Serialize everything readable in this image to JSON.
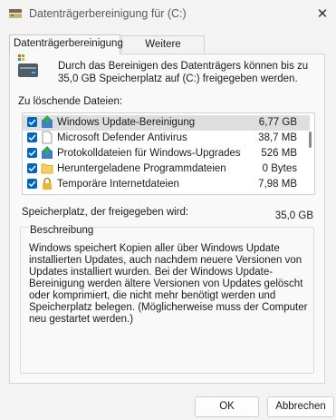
{
  "window": {
    "title": "Datenträgerbereinigung für  (C:)",
    "close_icon": "close-icon"
  },
  "tabs": [
    {
      "label": "Datenträgerbereinigung",
      "active": true
    },
    {
      "label": "Weitere Optionen",
      "active": false
    }
  ],
  "header": {
    "text": "Durch das Bereinigen des Datenträgers können bis zu 35,0 GB Speicherplatz auf  (C:) freigegeben werden."
  },
  "files_label": "Zu löschende Dateien:",
  "files": [
    {
      "name": "Windows Update-Bereinigung",
      "size": "6,77 GB",
      "checked": true,
      "icon": "windows-update-icon"
    },
    {
      "name": "Microsoft Defender Antivirus",
      "size": "38,7 MB",
      "checked": true,
      "icon": "file-icon"
    },
    {
      "name": "Protokolldateien für Windows-Upgrades",
      "size": "526 MB",
      "checked": true,
      "icon": "windows-upgrade-icon"
    },
    {
      "name": "Heruntergeladene Programmdateien",
      "size": "0 Bytes",
      "checked": true,
      "icon": "folder-icon"
    },
    {
      "name": "Temporäre Internetdateien",
      "size": "7,98 MB",
      "checked": true,
      "icon": "lock-icon"
    }
  ],
  "freed": {
    "label": "Speicherplatz, der freigegeben wird:",
    "value": "35,0 GB"
  },
  "description": {
    "title": "Beschreibung",
    "text": "Windows speichert Kopien aller über Windows Update installierten Updates, auch nachdem neuere Versionen von Updates installiert wurden. Bei der Windows Update-Bereinigung werden ältere Versionen von Updates gelöscht oder komprimiert, die nicht mehr benötigt werden und Speicherplatz belegen. (Möglicherweise muss der Computer neu gestartet werden.)"
  },
  "buttons": {
    "ok": "OK",
    "cancel": "Abbrechen"
  },
  "colors": {
    "accent": "#0067c0",
    "selection": "#dedede"
  }
}
